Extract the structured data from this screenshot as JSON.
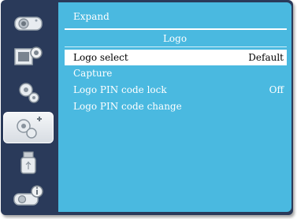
{
  "sidebar": {
    "tabs": [
      {
        "icon": "projector-icon",
        "active": false
      },
      {
        "icon": "image-settings-icon",
        "active": false
      },
      {
        "icon": "setting-gear-icon",
        "active": false
      },
      {
        "icon": "expanded-setting-gear-icon",
        "active": true
      },
      {
        "icon": "usb-memory-icon",
        "active": false
      },
      {
        "icon": "info-projector-icon",
        "active": false
      }
    ]
  },
  "panel": {
    "breadcrumb": "Expand",
    "subtitle": "Logo",
    "items": [
      {
        "label": "Logo select",
        "value": "Default",
        "selected": true
      },
      {
        "label": "Capture",
        "value": "",
        "selected": false
      },
      {
        "label": "Logo PIN code lock",
        "value": "Off",
        "selected": false
      },
      {
        "label": "Logo PIN code change",
        "value": "",
        "selected": false
      }
    ]
  },
  "colors": {
    "panel": "#4ab9e0",
    "frame": "#2a3a5a",
    "selected_row": "#ffffff"
  }
}
